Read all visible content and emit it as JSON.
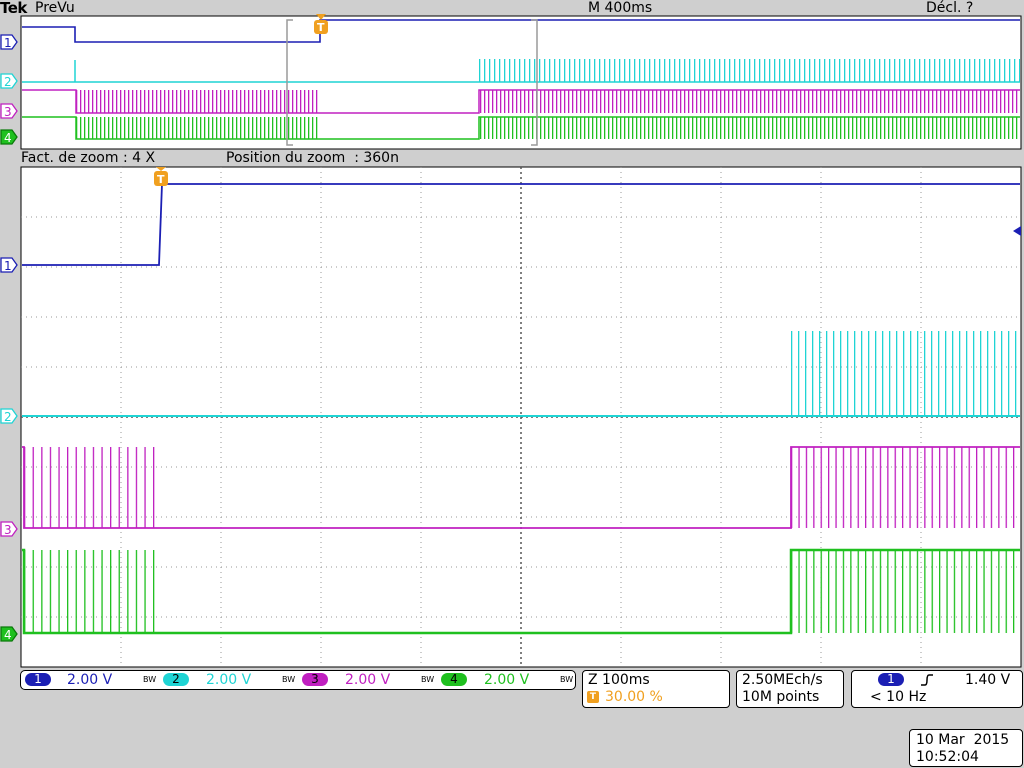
{
  "header": {
    "brand": "Tek",
    "mode": "PreVu",
    "timebase": "M 400ms",
    "trigger_status": "Décl. ?"
  },
  "zoom_bar": {
    "factor": "Fact. de zoom : 4 X",
    "position": "Position du zoom  : 360n"
  },
  "channel_markers": [
    "1",
    "2",
    "3",
    "4"
  ],
  "trigger_marker": "T",
  "channels": [
    {
      "number": "1",
      "scale": "2.00 V",
      "bw": "BW",
      "color": "#1b1fb4"
    },
    {
      "number": "2",
      "scale": "2.00 V",
      "bw": "BW",
      "color": "#1fd4d4"
    },
    {
      "number": "3",
      "scale": "2.00 V",
      "bw": "BW",
      "color": "#c020c0"
    },
    {
      "number": "4",
      "scale": "2.00 V",
      "bw": "BW",
      "color": "#1fc01f"
    }
  ],
  "zoom_info": {
    "label": "Z 100ms",
    "trigger_pos": "30.00 %"
  },
  "acquisition": {
    "rate": "2.50MEch/s",
    "points": "10M points"
  },
  "trigger": {
    "source": "1",
    "slope": "rising",
    "level": "1.40 V",
    "freq": "< 10 Hz"
  },
  "datetime": {
    "date": "10 Mar  2015",
    "time": "10:52:04"
  },
  "colors": {
    "ch1": "#1b1fb4",
    "ch2": "#1fd4d4",
    "ch3": "#c020c0",
    "ch4": "#1fc01f",
    "trigger": "#f0a020",
    "background": "#cfcfcf",
    "screen": "#ffffff"
  }
}
